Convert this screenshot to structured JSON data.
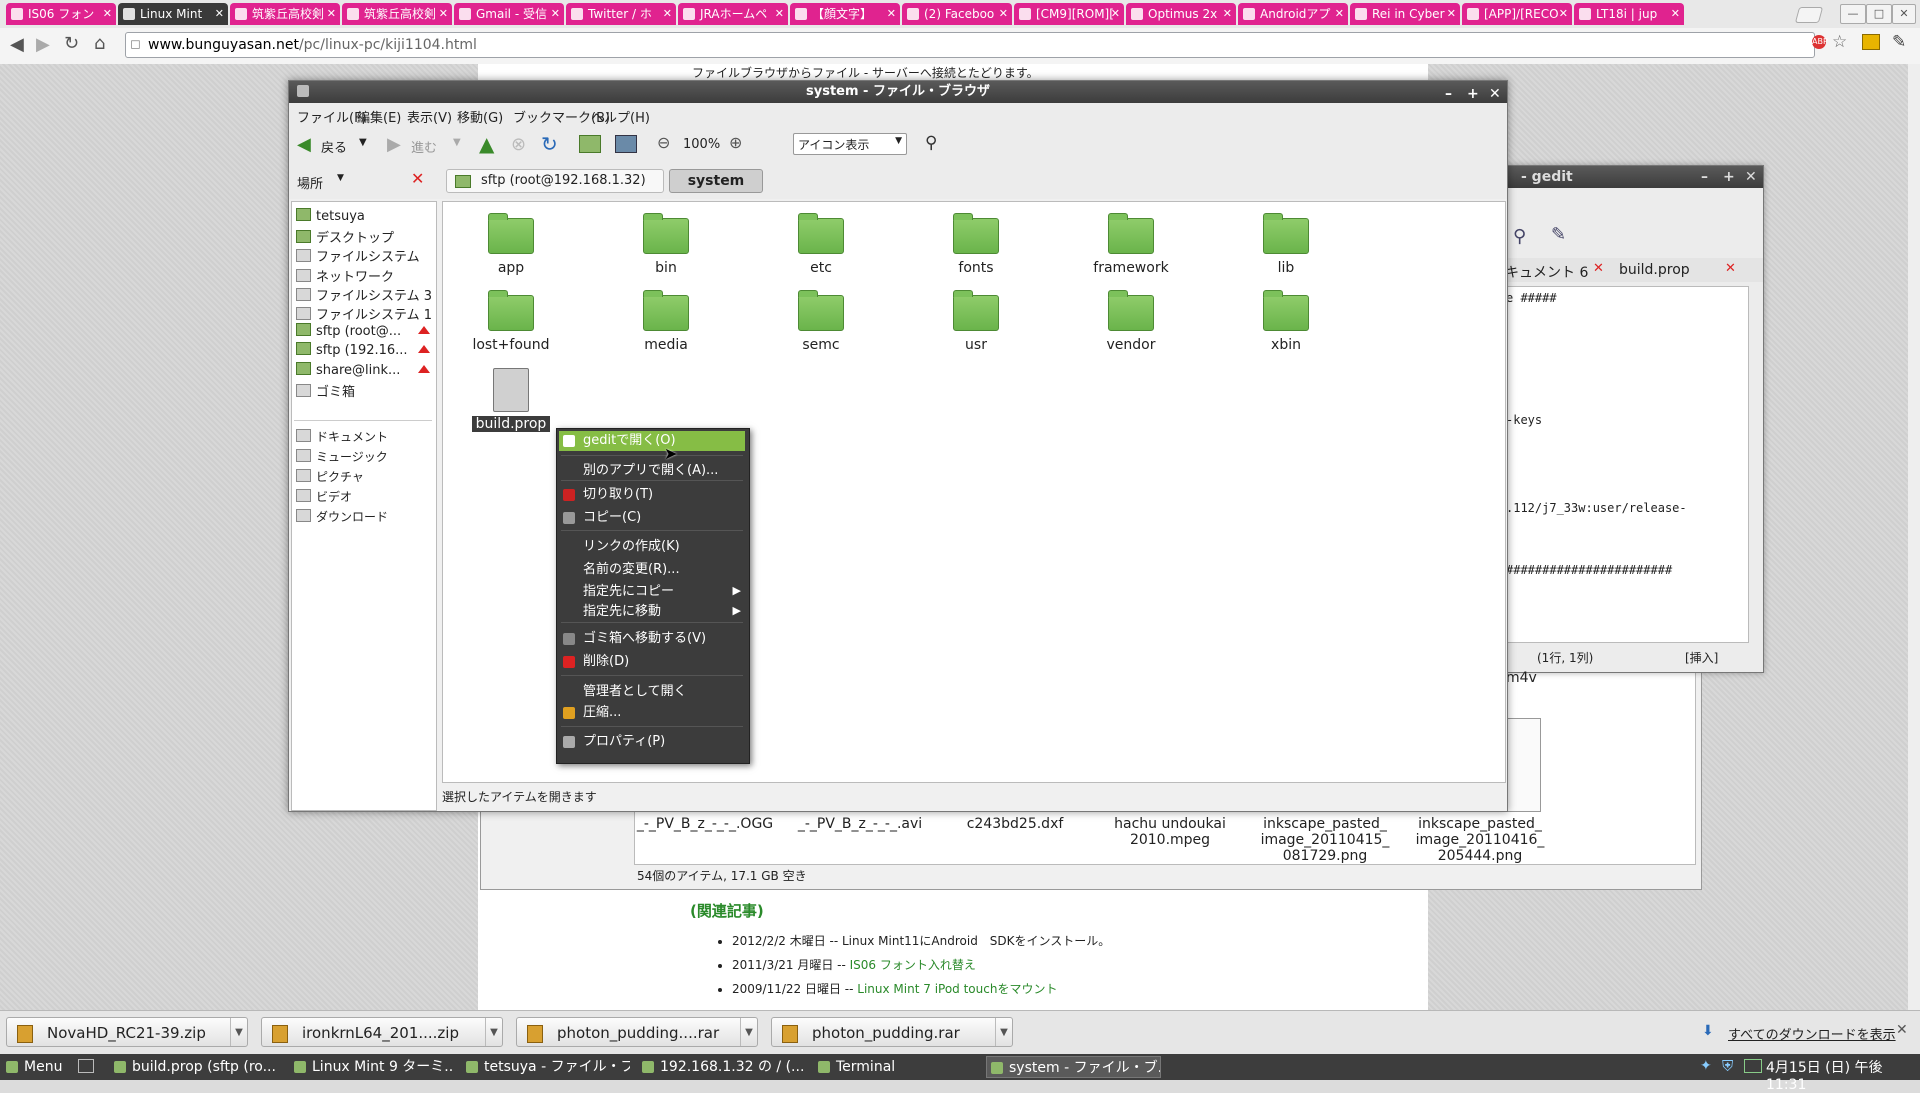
{
  "browser": {
    "tabs": [
      "IS06 フォン",
      "Linux Mint",
      "筑紫丘高校剣",
      "筑紫丘高校剣",
      "Gmail - 受信",
      "Twitter / ホ",
      "JRAホームペ",
      "【顔文字】",
      "(2) Faceboo",
      "[CM9][ROM][",
      "Optimus 2x",
      "Androidアプ",
      "Rei in Cyber",
      "[APP]/[RECO",
      "LT18i | jup"
    ],
    "active_tab_index": 1,
    "url_host": "www.bunguyasan.net",
    "url_path": "/pc/linux-pc/kiji1104.html",
    "page_top_text": "ファイルブラウザからファイル - サーバーへ接続とたどります。",
    "accent": "#e0238f"
  },
  "filemanager": {
    "title": "system - ファイル・ブラウザ",
    "menus": [
      "ファイル(F)",
      "編集(E)",
      "表示(V)",
      "移動(G)",
      "ブックマーク(B)",
      "ヘルプ(H)"
    ],
    "back_label": "戻る",
    "forward_label": "進む",
    "zoom": "100%",
    "view_mode": "アイコン表示",
    "places_label": "場所",
    "path_segments": [
      "sftp (root@192.168.1.32)",
      "system"
    ],
    "sidebar_places": [
      {
        "label": "tetsuya",
        "eject": false,
        "grey": false
      },
      {
        "label": "デスクトップ",
        "eject": false,
        "grey": false
      },
      {
        "label": "ファイルシステム",
        "eject": false,
        "grey": true
      },
      {
        "label": "ネットワーク",
        "eject": false,
        "grey": true
      },
      {
        "label": "ファイルシステム 3...",
        "eject": false,
        "grey": true
      },
      {
        "label": "ファイルシステム 1...",
        "eject": false,
        "grey": true
      },
      {
        "label": "sftp (root@...",
        "eject": true,
        "grey": false
      },
      {
        "label": "sftp (192.16...",
        "eject": true,
        "grey": false
      },
      {
        "label": "share@link...",
        "eject": true,
        "grey": false
      },
      {
        "label": "ゴミ箱",
        "eject": false,
        "grey": true
      }
    ],
    "sidebar_bookmarks": [
      "ドキュメント",
      "ミュージック",
      "ピクチャ",
      "ビデオ",
      "ダウンロード"
    ],
    "folders": [
      "app",
      "bin",
      "etc",
      "fonts",
      "framework",
      "lib",
      "lost+found",
      "media",
      "semc",
      "usr",
      "vendor",
      "xbin"
    ],
    "selected_file": "build.prop",
    "status": "選択したアイテムを開きます"
  },
  "context_menu": {
    "items": [
      {
        "label": "geditで開く(O)",
        "selected": true
      },
      {
        "label": "別のアプリで開く(A)..."
      },
      {
        "label": "切り取り(T)"
      },
      {
        "label": "コピー(C)"
      },
      {
        "label": "リンクの作成(K)"
      },
      {
        "label": "名前の変更(R)..."
      },
      {
        "label": "指定先にコピー"
      },
      {
        "label": "指定先に移動"
      },
      {
        "label": "ゴミ箱へ移動する(V)"
      },
      {
        "label": "削除(D)"
      },
      {
        "label": "管理者として開く"
      },
      {
        "label": "圧縮..."
      },
      {
        "label": "プロパティ(P)"
      }
    ]
  },
  "gedit": {
    "title": "- gedit",
    "tab1": "キュメント 6",
    "tab2": "build.prop",
    "lines": [
      "e #####",
      "-keys",
      ".112/j7_33w:user/release-",
      "#######################"
    ],
    "position": "(1行, 1列)",
    "mode": "[挿入]",
    "fragment": "m4v"
  },
  "bg_filemanager": {
    "files": [
      "_-_PV_B_z_-_-_.OGG",
      "_-_PV_B_z_-_-_.avi",
      "c243bd25.dxf",
      "hachu undoukai 2010.mpeg",
      "inkscape_pasted_ image_20110415_ 081729.png",
      "inkscape_pasted_ image_20110416_ 205444.png"
    ],
    "status": "54個のアイテム, 17.1 GB 空き"
  },
  "related": {
    "heading": "(関連記事)",
    "items": [
      {
        "date": "2012/2/2 木曜日 -- ",
        "text": "Linux Mint11にAndroid　SDKをインストール。",
        "link": false
      },
      {
        "date": "2011/3/21 月曜日 -- ",
        "text": "IS06 フォント入れ替え",
        "link": true
      },
      {
        "date": "2009/11/22 日曜日 -- ",
        "text": "Linux Mint 7 iPod touchをマウント",
        "link": true
      }
    ]
  },
  "downloads": {
    "items": [
      "NovaHD_RC21-39.zip",
      "ironkrnL64_201....zip",
      "photon_pudding....rar",
      "photon_pudding.rar"
    ],
    "show_all": "すべてのダウンロードを表示"
  },
  "taskbar": {
    "menu": "Menu",
    "items": [
      "build.prop (sftp (ro...",
      "Linux Mint 9 ターミ...",
      "tetsuya - ファイル・ブ...",
      "192.168.1.32 の / (...",
      "Terminal",
      "system - ファイル・ブ..."
    ],
    "active_index": 5,
    "clock": "4月15日 (日) 午後11:31"
  }
}
